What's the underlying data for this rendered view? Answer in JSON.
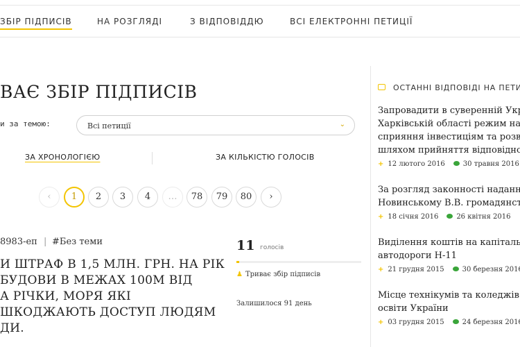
{
  "tabs": [
    {
      "label": "ЗБІР ПІДПИСІВ",
      "active": true
    },
    {
      "label": "НА РОЗГЛЯДІ",
      "active": false
    },
    {
      "label": "З ВІДПОВІДДЮ",
      "active": false
    },
    {
      "label": "ВСІ ЕЛЕКТРОННІ ПЕТИЦІЇ",
      "active": false
    }
  ],
  "heading": "ВАЄ ЗБІР ПІДПИСІВ",
  "filter": {
    "label": "и за темою:",
    "value": "Всі петиції"
  },
  "sort": {
    "chronology": "ЗА ХРОНОЛОГІЄЮ",
    "votes": "ЗА КІЛЬКІСТЮ ГОЛОСІВ"
  },
  "pagination": {
    "pages": [
      "1",
      "2",
      "3",
      "4",
      "…",
      "78",
      "79",
      "80"
    ],
    "current": "1",
    "prev": "‹",
    "next": "›"
  },
  "petition": {
    "id": "8983-еп",
    "theme": "#Без теми",
    "title_lines": [
      "И ШТРАФ В 1,5 МЛН. ГРН. НА РІК",
      "БУДОВИ В МЕЖАХ 100М ВІД",
      "А РІЧКИ, МОРЯ ЯКІ",
      "ШКОДЖАЮТЬ ДОСТУП ЛЮДЯМ",
      "ДИ."
    ],
    "votes": "11",
    "votes_label": "голосів",
    "progress_fraction": 0.02,
    "status": "Триває збір підписів",
    "remaining": "Залишилося 91 день"
  },
  "sidebar": {
    "heading": "ОСТАННІ ВІДПОВІДІ НА ПЕТИ",
    "items": [
      {
        "title_lines": [
          "Запровадити в суверенній Укра",
          "Харківській області режим найб",
          "сприяння інвестиціям та розвит",
          "шляхом прийняття відповідног"
        ],
        "date": "12 лютого 2016",
        "answer": "30 травня 2016"
      },
      {
        "title_lines": [
          "За розгляд законності надання",
          "Новинському В.В. громадянства"
        ],
        "date": "18 січня 2016",
        "answer": "26 квітня 2016"
      },
      {
        "title_lines": [
          "Виділення коштів на капітальн",
          "автодороги Н-11"
        ],
        "date": "21 грудня 2015",
        "answer": "30 березня 2016"
      },
      {
        "title_lines": [
          "Місце технікумів та коледжів в",
          "освіти України"
        ],
        "date": "03 грудня 2015",
        "answer": "24 березня 2016"
      }
    ]
  },
  "colors": {
    "accent": "#f3c400",
    "answer_icon": "#3aa53a"
  }
}
